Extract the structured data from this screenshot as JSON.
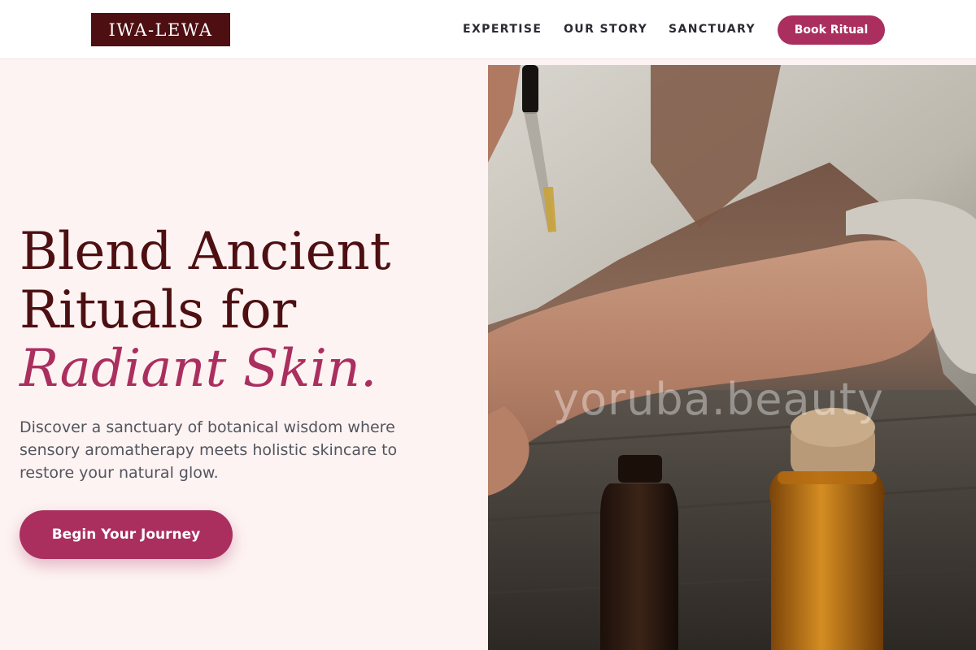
{
  "header": {
    "logo_text": "IWA-LEWA",
    "nav": [
      {
        "label": "EXPERTISE"
      },
      {
        "label": "OUR STORY"
      },
      {
        "label": "SANCTUARY"
      }
    ],
    "cta_label": "Book Ritual"
  },
  "hero": {
    "headline_line1": "Blend Ancient",
    "headline_line2": "Rituals for",
    "headline_accent": "Radiant Skin.",
    "subtext": "Discover a sanctuary of botanical wisdom where sensory aromatherapy meets holistic skincare to restore your natural glow.",
    "cta_label": "Begin Your Journey",
    "image_watermark": "yoruba.beauty"
  },
  "colors": {
    "brand_dark": "#4d0f12",
    "accent": "#aa2f5f",
    "hero_background": "#fdf3f2",
    "text_muted": "#52555f"
  }
}
